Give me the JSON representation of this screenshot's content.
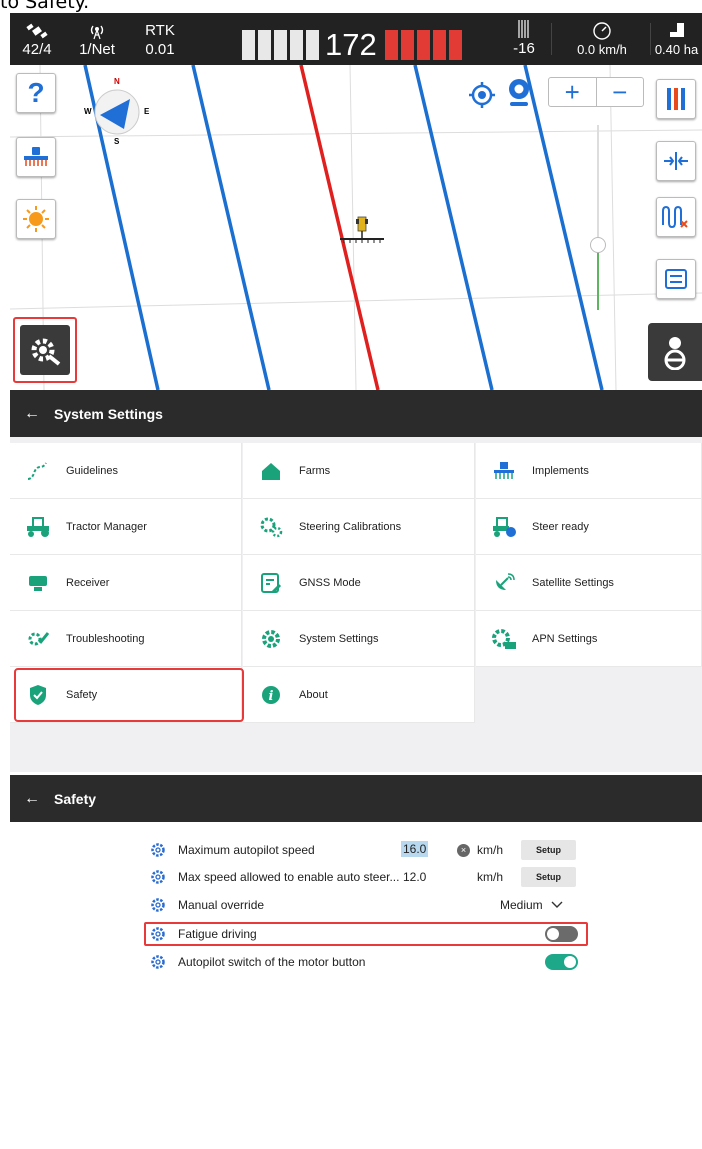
{
  "caption": "to Safety.",
  "status": {
    "satellites": "42/4",
    "network": "1/Net",
    "mode_label": "RTK",
    "mode_value": "0.01",
    "lightbar_value": "172",
    "offset": "-16",
    "speed": "0.0 km/h",
    "area": "0.40 ha"
  },
  "compass": {
    "n": "N",
    "e": "E",
    "s": "S",
    "w": "W"
  },
  "map": {
    "help_label": "?",
    "zoom_in": "+",
    "zoom_out": "−"
  },
  "system_settings": {
    "title": "System Settings",
    "back": "←",
    "items": [
      {
        "label": "Guidelines",
        "icon": "guidelines-icon"
      },
      {
        "label": "Farms",
        "icon": "farm-icon"
      },
      {
        "label": "Implements",
        "icon": "implement-icon"
      },
      {
        "label": "Tractor Manager",
        "icon": "tractor-icon"
      },
      {
        "label": "Steering Calibrations",
        "icon": "steering-calibration-icon"
      },
      {
        "label": "Steer ready",
        "icon": "steer-ready-icon"
      },
      {
        "label": "Receiver",
        "icon": "receiver-icon"
      },
      {
        "label": "GNSS Mode",
        "icon": "gnss-mode-icon"
      },
      {
        "label": "Satellite Settings",
        "icon": "satellite-icon"
      },
      {
        "label": "Troubleshooting",
        "icon": "troubleshooting-icon"
      },
      {
        "label": "System Settings",
        "icon": "gear-icon"
      },
      {
        "label": "APN Settings",
        "icon": "apn-icon"
      },
      {
        "label": "Safety",
        "icon": "shield-icon"
      },
      {
        "label": "About",
        "icon": "info-icon"
      }
    ]
  },
  "safety": {
    "title": "Safety",
    "back": "←",
    "rows": {
      "max_autopilot_speed": {
        "label": "Maximum autopilot speed",
        "value": "16.0",
        "unit": "km/h",
        "button": "Setup"
      },
      "max_speed_enable": {
        "label": "Max speed allowed to enable auto steer...",
        "value": "12.0",
        "unit": "km/h",
        "button": "Setup"
      },
      "manual_override": {
        "label": "Manual override",
        "value": "Medium"
      },
      "fatigue_driving": {
        "label": "Fatigue driving",
        "enabled": false
      },
      "autopilot_switch": {
        "label": "Autopilot switch of the motor button",
        "enabled": true
      }
    }
  },
  "colors": {
    "accent_blue": "#1f6fd6",
    "highlight_red": "#e83a3a",
    "toggle_on": "#1ea88a",
    "toggle_off": "#6b6b6b",
    "lightbar_red": "#e23b35"
  }
}
